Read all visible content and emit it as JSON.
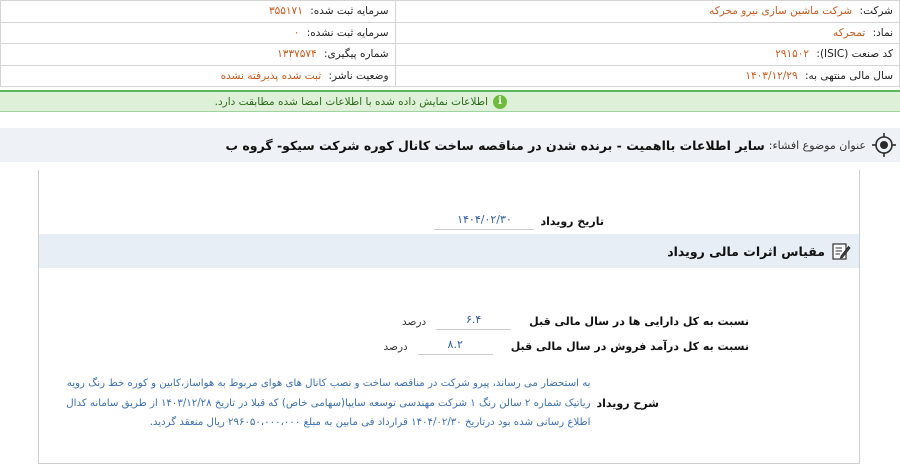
{
  "company": {
    "name_label": "شرکت:",
    "name_value": "شرکت ماشین سازی نیرو محرکه",
    "symbol_label": "نماد:",
    "symbol_value": "تمحرکه",
    "isic_label": "کد صنعت (ISIC):",
    "isic_value": "۲۹۱۵۰۲",
    "fiscal_label": "سال مالی منتهی به:",
    "fiscal_value": "۱۴۰۳/۱۲/۲۹",
    "reg_capital_label": "سرمایه ثبت شده:",
    "reg_capital_value": "۳۵۵۱۷۱",
    "unreg_capital_label": "سرمایه ثبت نشده:",
    "unreg_capital_value": "۰",
    "tracking_label": "شماره پیگیری:",
    "tracking_value": "۱۳۳۷۵۷۴",
    "status_label": "وضعیت ناشر:",
    "status_value": "ثبت شده پذیرفته نشده"
  },
  "notice": {
    "text": "اطلاعات نمایش داده شده با اطلاعات امضا شده مطابقت دارد."
  },
  "subject": {
    "label": "عنوان موضوع افشاء:",
    "text": "سایر اطلاعات بااهمیت - برنده شدن در مناقصه ساخت کانال کوره شرکت سیکو- گروه ب"
  },
  "event": {
    "date_label": "تاریخ رویداد",
    "date_value": "۱۴۰۴/۰۲/۳۰"
  },
  "section": {
    "title": "مقیاس اثرات مالی رویداد"
  },
  "ratios": [
    {
      "label": "نسبت به کل دارایی ها در سال مالی قبل",
      "value": "۶.۴",
      "unit": "درصد"
    },
    {
      "label": "نسبت به کل درآمد فروش در سال مالی قبل",
      "value": "۸.۲",
      "unit": "درصد"
    }
  ],
  "description": {
    "label": "شرح رویداد",
    "text": "به استحضار می رساند، پیرو شرکت در مناقصه ساخت و نصب کانال های هوای مربوط به هواساز،کابین و کوره خط رنگ رویه ریاتیک شماره ۲ سالن رنگ ۱ شرکت مهندسی توسعه سایپا(سهامی خاص) که قبلا در تاریخ ۱۴۰۳/۱۲/۲۸ از طریق سامانه کدال اطلاع رسانی شده بود درتاریخ ۱۴۰۴/۰۲/۳۰ قرارداد فی مابین به مبلغ ۲۹۶۰۵۰،۰۰۰،۰۰۰ ریال منعقد گردید."
  },
  "colors": {
    "value_orange": "#c85a1e",
    "value_blue": "#2f5fa5",
    "notice_green": "#dff0d8",
    "subject_bg": "#eef2f6"
  }
}
